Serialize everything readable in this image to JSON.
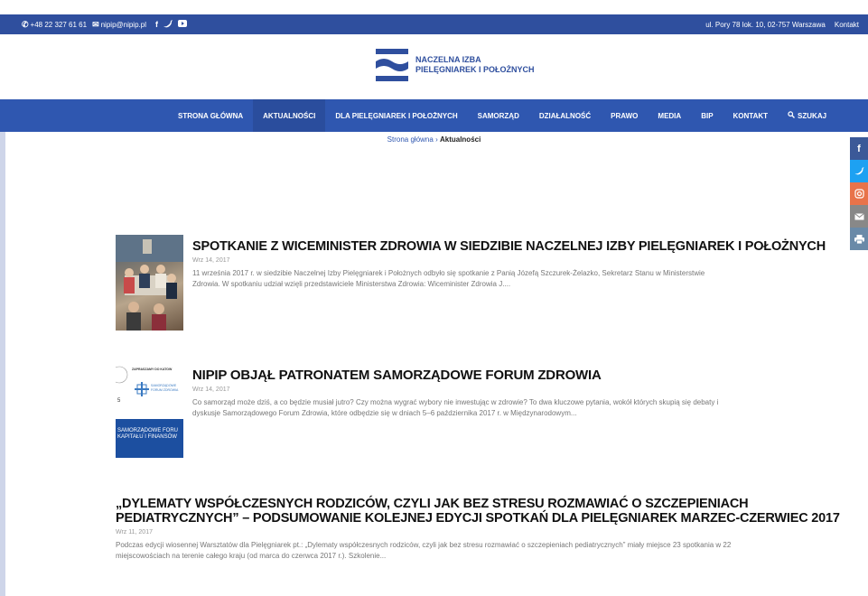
{
  "topbar": {
    "phone": "+48 22 327 61 61",
    "email": "nipip@nipip.pl",
    "address": "ul. Pory 78 lok. 10, 02-757 Warszawa",
    "contact": "Kontakt"
  },
  "header": {
    "logo_line1": "NACZELNA IZBA",
    "logo_line2": "PIELĘGNIAREK I POŁOŻNYCH"
  },
  "nav": {
    "items": [
      {
        "label": "STRONA GŁÓWNA"
      },
      {
        "label": "AKTUALNOŚCI"
      },
      {
        "label": "DLA PIELĘGNIAREK I POŁOŻNYCH"
      },
      {
        "label": "SAMORZĄD"
      },
      {
        "label": "DZIAŁALNOŚĆ"
      },
      {
        "label": "PRAWO"
      },
      {
        "label": "MEDIA"
      },
      {
        "label": "BIP"
      },
      {
        "label": "KONTAKT"
      },
      {
        "label": "SZUKAJ"
      }
    ]
  },
  "breadcrumb": {
    "home": "Strona główna",
    "separator": "›",
    "current": "Aktualności"
  },
  "share": {
    "colors": {
      "facebook": "#3b5998",
      "twitter": "#1da1f2",
      "instagram": "#e8734a",
      "email": "#888888",
      "print": "#6a8aa8"
    }
  },
  "articles": [
    {
      "title": "SPOTKANIE Z WICEMINISTER ZDROWIA W SIEDZIBIE NACZELNEJ IZBY PIELĘGNIAREK I POŁOŻNYCH",
      "date": "Wrz 14, 2017",
      "excerpt": "11 września 2017 r. w siedzibie Naczelnej Izby Pielęgniarek i Położnych odbyło się spotkanie z Panią Józefą Szczurek-Żelazko, Sekretarz Stanu w Ministerstwie Zdrowia. W spotkaniu udział wzięli przedstawiciele Ministerstwa Zdrowia: Wiceminister Zdrowia J...."
    },
    {
      "title": "NIPIP OBJĄŁ PATRONATEM SAMORZĄDOWE FORUM ZDROWIA",
      "date": "Wrz 14, 2017",
      "excerpt": "Co samorząd może dziś, a co będzie musiał jutro? Czy można wygrać wybory nie inwestując w zdrowie? To dwa kluczowe pytania, wokół których skupią się debaty i dyskusje Samorządowego Forum Zdrowia, które odbędzie się w dniach 5–6 października 2017 r. w Międzynarodowym...",
      "thumb_text1": "ZAPRASZAMY DO KATOW",
      "thumb_text2": "SAMORZĄDOWE FORUM ZDROWIA",
      "thumb_text3": "SAMORZĄDOWE FORU KAPITAŁU I FINANSÓW"
    },
    {
      "title_line1": "„DYLEMATY WSPÓŁCZESNYCH RODZICÓW, CZYLI JAK BEZ STRESU ROZMAWIAĆ O SZCZEPIENIACH",
      "title_line2": "PEDIATRYCZNYCH” – PODSUMOWANIE KOLEJNEJ EDYCJI SPOTKAŃ DLA PIELĘGNIAREK MARZEC-CZERWIEC 2017",
      "date": "Wrz 11, 2017",
      "excerpt": "Podczas edycji wiosennej Warsztatów dla Pielęgniarek pt.: „Dylematy współczesnych rodziców, czyli jak bez stresu rozmawiać o szczepieniach pediatrycznych” miały miejsce 23 spotkania w 22 miejscowościach na terenie całego kraju (od marca do czerwca 2017 r.). Szkolenie..."
    }
  ]
}
